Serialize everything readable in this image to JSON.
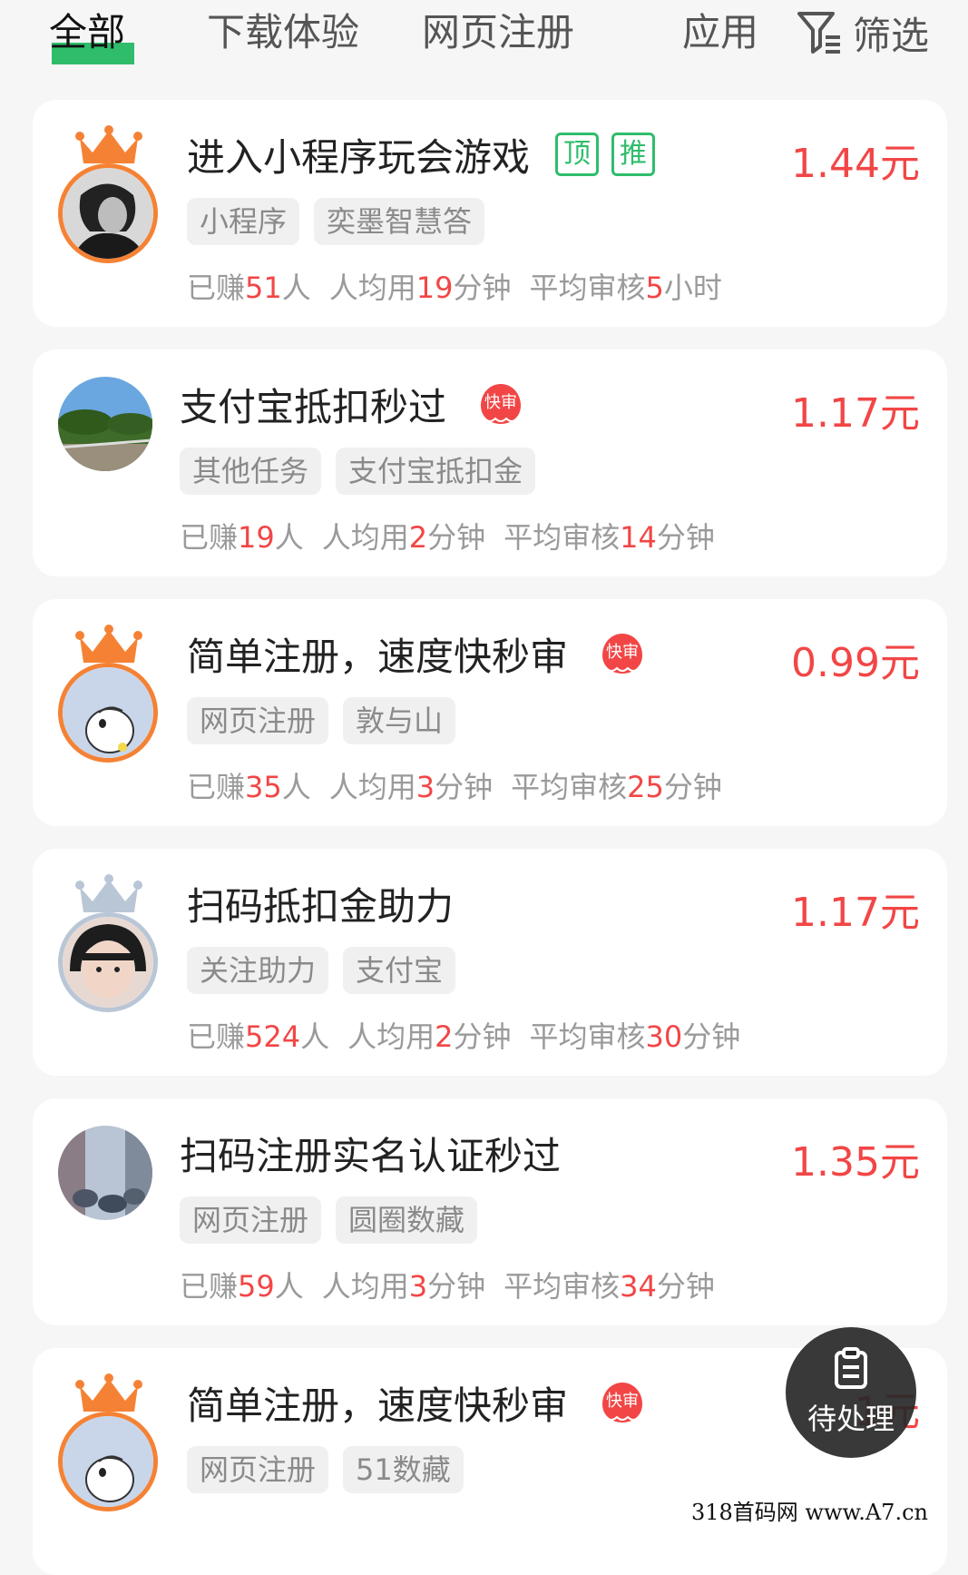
{
  "tabs": [
    {
      "label": "全部",
      "active": true
    },
    {
      "label": "下载体验",
      "active": false
    },
    {
      "label": "网页注册",
      "active": false
    },
    {
      "label": "应用",
      "active": false
    }
  ],
  "filter": {
    "label": "筛选",
    "icon": "filter-icon"
  },
  "stat_labels": {
    "earned_prefix": "已赚",
    "earned_suffix": "人",
    "avg_prefix": "人均用",
    "avg_suffix": "分钟",
    "review_prefix": "平均审核"
  },
  "tasks": [
    {
      "title": "进入小程序玩会游戏",
      "badges": [
        "顶",
        "推"
      ],
      "fast_badge": "",
      "price": "1.44元",
      "tags": [
        "小程序",
        "奕墨智慧答"
      ],
      "earned": "51",
      "avg_minutes": "19",
      "review_value": "5",
      "review_unit": "小时",
      "avatar": "photo-bw-woman",
      "ring": "orange",
      "crown": "orange"
    },
    {
      "title": "支付宝抵扣秒过",
      "badges": [],
      "fast_badge": "快审",
      "price": "1.17元",
      "tags": [
        "其他任务",
        "支付宝抵扣金"
      ],
      "earned": "19",
      "avg_minutes": "2",
      "review_value": "14",
      "review_unit": "分钟",
      "avatar": "photo-landscape",
      "ring": "none",
      "crown": ""
    },
    {
      "title": "简单注册，速度快秒审",
      "badges": [],
      "fast_badge": "快审",
      "price": "0.99元",
      "tags": [
        "网页注册",
        "敦与山"
      ],
      "earned": "35",
      "avg_minutes": "3",
      "review_value": "25",
      "review_unit": "分钟",
      "avatar": "cartoon-hamster",
      "ring": "orange",
      "crown": "orange"
    },
    {
      "title": "扫码抵扣金助力",
      "badges": [],
      "fast_badge": "",
      "price": "1.17元",
      "tags": [
        "关注助力",
        "支付宝"
      ],
      "earned": "524",
      "avg_minutes": "2",
      "review_value": "30",
      "review_unit": "分钟",
      "avatar": "photo-girl",
      "ring": "silver",
      "crown": "silver"
    },
    {
      "title": "扫码注册实名认证秒过",
      "badges": [],
      "fast_badge": "",
      "price": "1.35元",
      "tags": [
        "网页注册",
        "圆圈数藏"
      ],
      "earned": "59",
      "avg_minutes": "3",
      "review_value": "34",
      "review_unit": "分钟",
      "avatar": "photo-street",
      "ring": "none",
      "crown": ""
    },
    {
      "title": "简单注册，速度快秒审",
      "badges": [],
      "fast_badge": "快审",
      "price": "1元",
      "tags": [
        "网页注册",
        "51数藏"
      ],
      "earned": "",
      "avg_minutes": "",
      "review_value": "",
      "review_unit": "",
      "avatar": "cartoon-hamster",
      "ring": "orange",
      "crown": "orange"
    }
  ],
  "pending_button": {
    "label": "待处理",
    "icon": "clipboard-icon"
  },
  "watermark": "318首码网 www.A7.cn",
  "colors": {
    "accent_green": "#2fbd6b",
    "price_red": "#f24646",
    "crown_orange": "#f58234",
    "crown_silver": "#b9c6d6"
  }
}
